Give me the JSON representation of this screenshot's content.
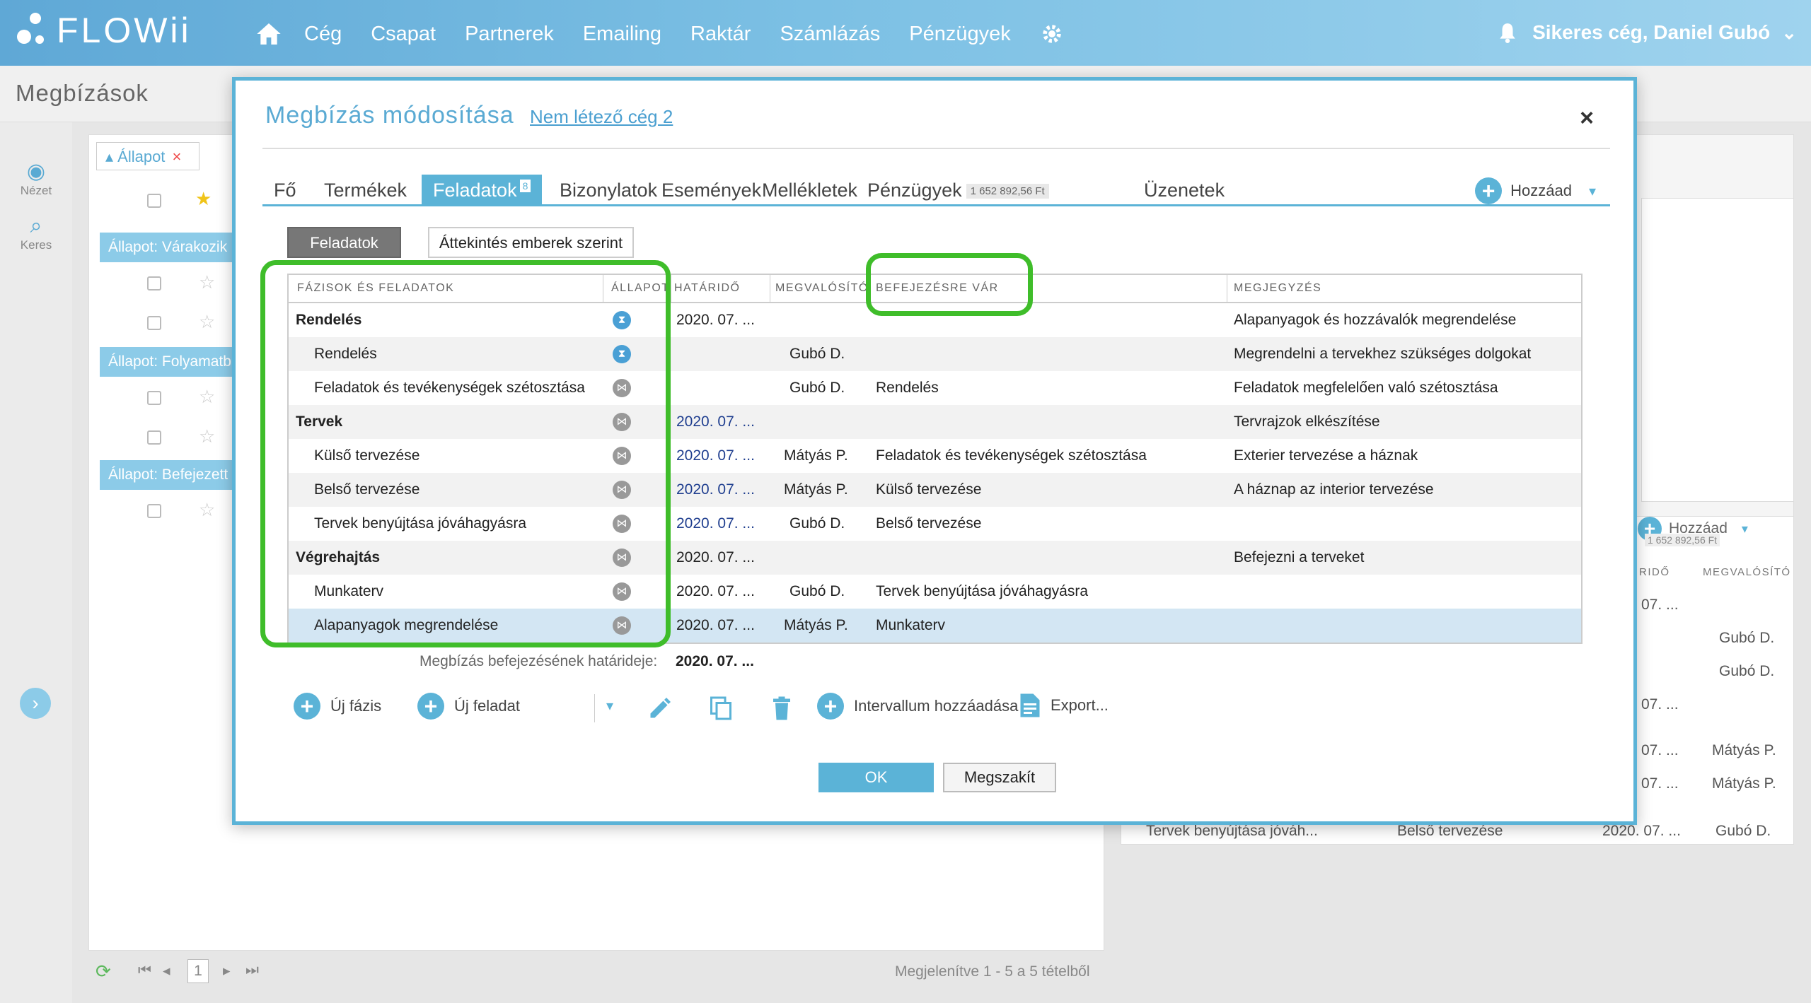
{
  "app": {
    "logo_text": "FLOWii"
  },
  "nav": {
    "items": [
      "Cég",
      "Csapat",
      "Partnerek",
      "Emailing",
      "Raktár",
      "Számlázás",
      "Pénzügyek"
    ],
    "user": "Sikeres cég, Daniel Gubó"
  },
  "page": {
    "title": "Megbízások",
    "rail": {
      "view": "Nézet",
      "search": "Keres"
    },
    "filter_chip": "Állapot",
    "groups": [
      "Állapot: Várakozik",
      "Állapot: Folyamatb",
      "Állapot: Befejezett"
    ],
    "pager": {
      "page": "1",
      "info": "Megjelenítve 1 - 5 a 5 tételből"
    },
    "right": {
      "add_label": "Hozzáad",
      "amount": "1 652 892,56 Ft",
      "col_deadline": "RIDŐ",
      "col_impl": "MEGVALÓSÍTÓ",
      "rows": [
        {
          "date": "07. ...",
          "impl": ""
        },
        {
          "date": "",
          "impl": "Gubó D."
        },
        {
          "date": "",
          "impl": "Gubó D."
        },
        {
          "date": "07. ...",
          "impl": ""
        },
        {
          "date": "07. ...",
          "impl": "Mátyás P."
        },
        {
          "date": "07. ...",
          "impl": "Mátyás P."
        }
      ],
      "last_row": {
        "task": "Tervek benyújtása jóváh...",
        "waits": "Belső tervezése",
        "date": "2020. 07. ...",
        "impl": "Gubó D."
      }
    }
  },
  "modal": {
    "title": "Megbízás módosítása",
    "link": "Nem létező cég 2",
    "close": "×",
    "tabs": [
      {
        "label": "Fő"
      },
      {
        "label": "Termékek"
      },
      {
        "label": "Feladatok",
        "badge": "8"
      },
      {
        "label": "Bizonylatok"
      },
      {
        "label": "Események"
      },
      {
        "label": "Mellékletek"
      },
      {
        "label": "Pénzügyek",
        "amount": "1 652 892,56 Ft"
      },
      {
        "label": "Üzenetek"
      }
    ],
    "add_label": "Hozzáad",
    "view_buttons": {
      "tasks": "Feladatok",
      "by_people": "Áttekintés emberek szerint"
    },
    "columns": {
      "task": "FÁZISOK ÉS FELADATOK",
      "status": "ÁLLAPOT",
      "deadline": "HATÁRIDŐ",
      "implementer": "MEGVALÓSÍTÓ",
      "waits_for": "BEFEJEZÉSRE VÁR",
      "note": "MEGJEGYZÉS"
    },
    "rows": [
      {
        "task": "Rendelés",
        "phase": true,
        "status": "waiting",
        "deadline": "2020. 07. ...",
        "blue": false,
        "impl": "",
        "waits": "",
        "note": "Alapanyagok és hozzávalók megrendelése"
      },
      {
        "task": "Rendelés",
        "phase": false,
        "status": "waiting",
        "deadline": "",
        "blue": false,
        "impl": "Gubó D.",
        "waits": "",
        "note": "Megrendelni a tervekhez szükséges dolgokat"
      },
      {
        "task": "Feladatok és tevékenységek szétosztása",
        "phase": false,
        "status": "todo",
        "deadline": "",
        "blue": false,
        "impl": "Gubó D.",
        "waits": "Rendelés",
        "note": "Feladatok megfelelően való szétosztása"
      },
      {
        "task": "Tervek",
        "phase": true,
        "status": "todo",
        "deadline": "2020. 07. ...",
        "blue": true,
        "impl": "",
        "waits": "",
        "note": "Tervrajzok elkészítése"
      },
      {
        "task": "Külső tervezése",
        "phase": false,
        "status": "todo",
        "deadline": "2020. 07. ...",
        "blue": true,
        "impl": "Mátyás P.",
        "waits": "Feladatok és tevékenységek szétosztása",
        "note": "Exterier tervezése a háznak"
      },
      {
        "task": "Belső tervezése",
        "phase": false,
        "status": "todo",
        "deadline": "2020. 07. ...",
        "blue": true,
        "impl": "Mátyás P.",
        "waits": "Külső tervezése",
        "note": "A háznap az interior tervezése"
      },
      {
        "task": "Tervek benyújtása jóváhagyásra",
        "phase": false,
        "status": "todo",
        "deadline": "2020. 07. ...",
        "blue": true,
        "impl": "Gubó D.",
        "waits": "Belső tervezése",
        "note": ""
      },
      {
        "task": "Végrehajtás",
        "phase": true,
        "status": "todo",
        "deadline": "2020. 07. ...",
        "blue": false,
        "impl": "",
        "waits": "",
        "note": "Befejezni a terveket"
      },
      {
        "task": "Munkaterv",
        "phase": false,
        "status": "todo",
        "deadline": "2020. 07. ...",
        "blue": false,
        "impl": "Gubó D.",
        "waits": "Tervek benyújtása jóváhagyásra",
        "note": ""
      },
      {
        "task": "Alapanyagok megrendelése",
        "phase": false,
        "status": "todo",
        "deadline": "2020. 07. ...",
        "blue": false,
        "impl": "Mátyás P.",
        "waits": "Munkaterv",
        "note": "",
        "selected": true
      }
    ],
    "deadline_label": "Megbízás befejezésének határideje:",
    "deadline_value": "2020. 07. ...",
    "toolbar": {
      "new_phase": "Új fázis",
      "new_task": "Új feladat",
      "add_interval": "Intervallum hozzáadása",
      "export": "Export..."
    },
    "ok": "OK",
    "cancel": "Megszakít"
  },
  "colors": {
    "accent": "#5bb3d7",
    "highlight": "#3fbd2a",
    "selected_row": "#d3e6f3"
  }
}
